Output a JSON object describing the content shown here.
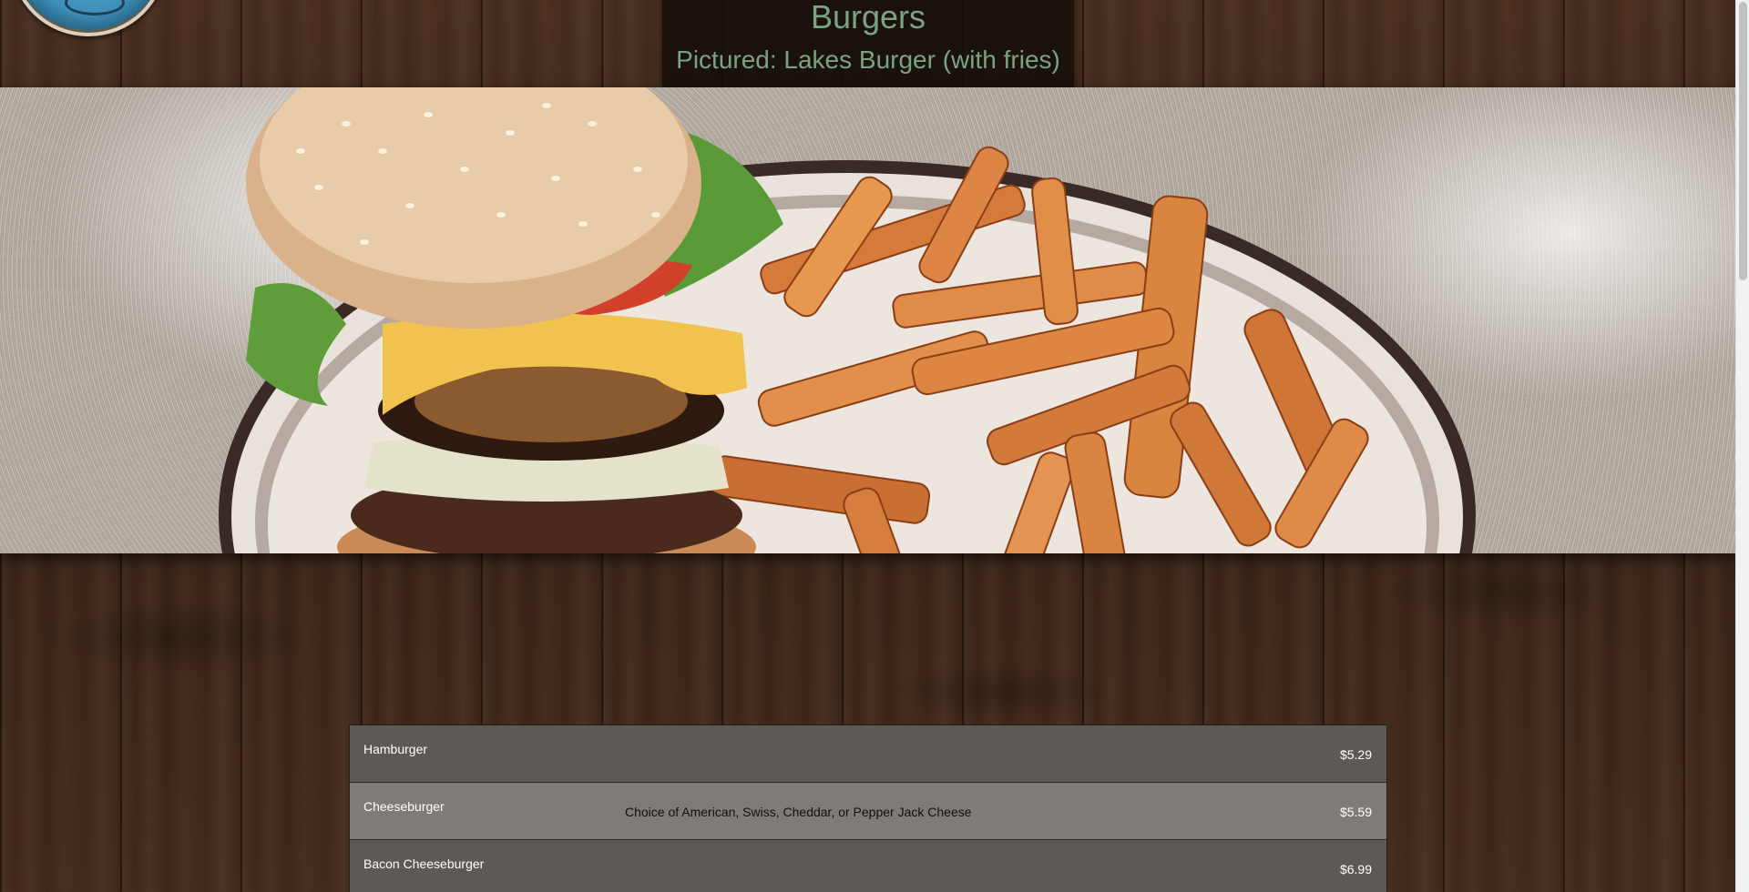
{
  "header": {
    "title": "Burgers",
    "subtitle": "Pictured: Lakes Burger (with fries)"
  },
  "hero": {
    "alt": "Lakes Burger with fries on a plate"
  },
  "menu": {
    "items": [
      {
        "name": "Hamburger",
        "description": "",
        "price": "$5.29"
      },
      {
        "name": "Cheeseburger",
        "description": "Choice of American, Swiss, Cheddar, or Pepper Jack Cheese",
        "price": "$5.59"
      },
      {
        "name": "Bacon Cheeseburger",
        "description": "",
        "price": "$6.99"
      }
    ]
  },
  "colors": {
    "title_text": "#7aa383",
    "row_dark": "#5e5955",
    "row_light": "#7f7b77"
  },
  "icons": {
    "logo": "restaurant-logo-icon"
  }
}
